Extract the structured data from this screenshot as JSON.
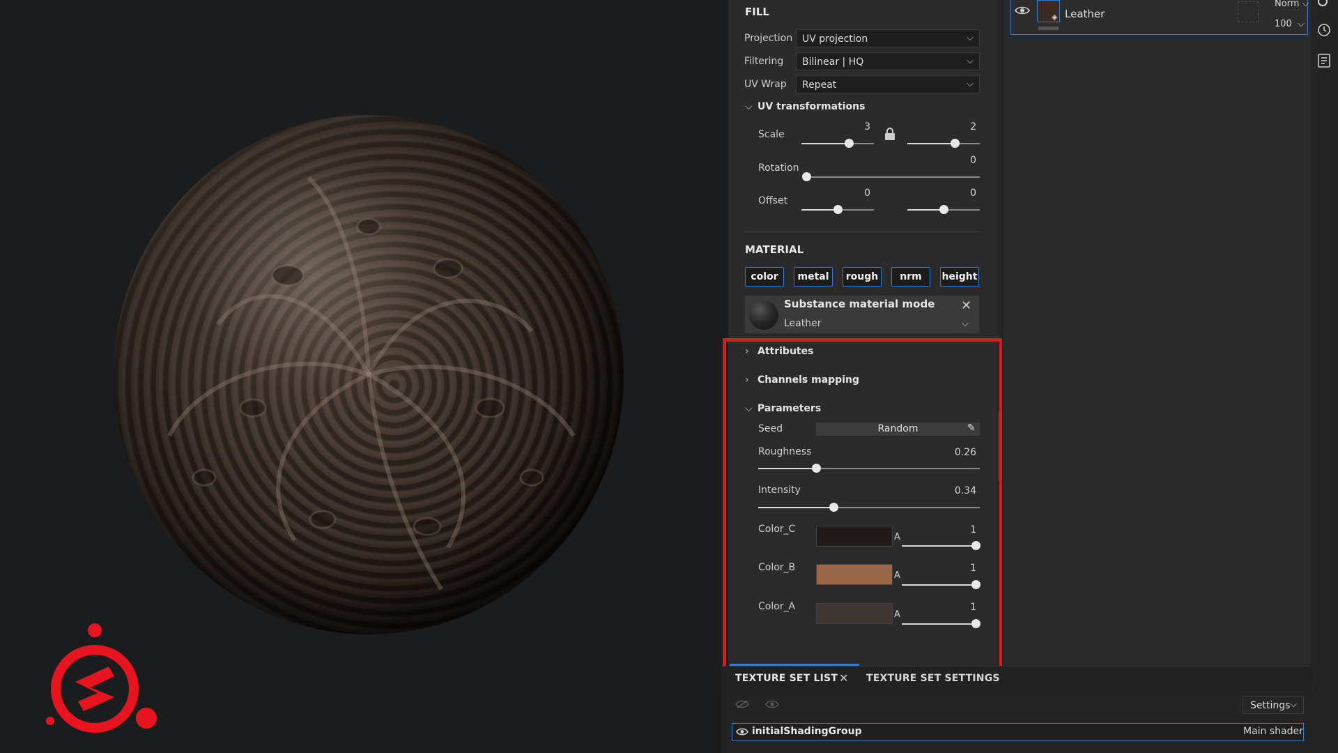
{
  "fill": {
    "title": "FILL",
    "projection": {
      "label": "Projection",
      "value": "UV projection"
    },
    "filtering": {
      "label": "Filtering",
      "value": "Bilinear | HQ"
    },
    "uvwrap": {
      "label": "UV Wrap",
      "value": "Repeat"
    },
    "uv_transformations": {
      "title": "UV transformations",
      "scale": {
        "label": "Scale",
        "value1": "3",
        "value2": "2",
        "level1": 0.65,
        "level2": 0.65
      },
      "rotation": {
        "label": "Rotation",
        "value": "0",
        "level": 0.0
      },
      "offset": {
        "label": "Offset",
        "value1": "0",
        "value2": "0",
        "level1": 0.5,
        "level2": 0.5
      }
    }
  },
  "material": {
    "title": "MATERIAL",
    "channels": [
      "color",
      "metal",
      "rough",
      "nrm",
      "height"
    ],
    "mode_title": "Substance material mode",
    "mode_value": "Leather",
    "groups": {
      "attributes": "Attributes",
      "channels_mapping": "Channels mapping",
      "parameters": "Parameters"
    },
    "seed": {
      "label": "Seed",
      "value": "Random"
    },
    "roughness": {
      "label": "Roughness",
      "value": "0.26",
      "level": 0.26
    },
    "intensity": {
      "label": "Intensity",
      "value": "0.34",
      "level": 0.34
    },
    "colors": [
      {
        "label": "Color_C",
        "swatch": "#221b1c",
        "alpha_label": "A",
        "alpha": "1",
        "level": 1.0
      },
      {
        "label": "Color_B",
        "swatch": "#9a6647",
        "alpha_label": "A",
        "alpha": "1",
        "level": 1.0
      },
      {
        "label": "Color_A",
        "swatch": "#3e3733",
        "alpha_label": "A",
        "alpha": "1",
        "level": 1.0
      }
    ]
  },
  "layers": {
    "layer_name": "Leather",
    "blend_mode": "Norm",
    "opacity": "100"
  },
  "texture_set": {
    "tab_list": "TEXTURE SET LIST",
    "tab_settings": "TEXTURE SET SETTINGS",
    "settings_label": "Settings",
    "shading_group": "initialShadingGroup",
    "shader": "Main shader"
  },
  "colors": {
    "accent": "#2e7fd6",
    "highlight": "#e8141f",
    "logo": "#e8141f"
  }
}
